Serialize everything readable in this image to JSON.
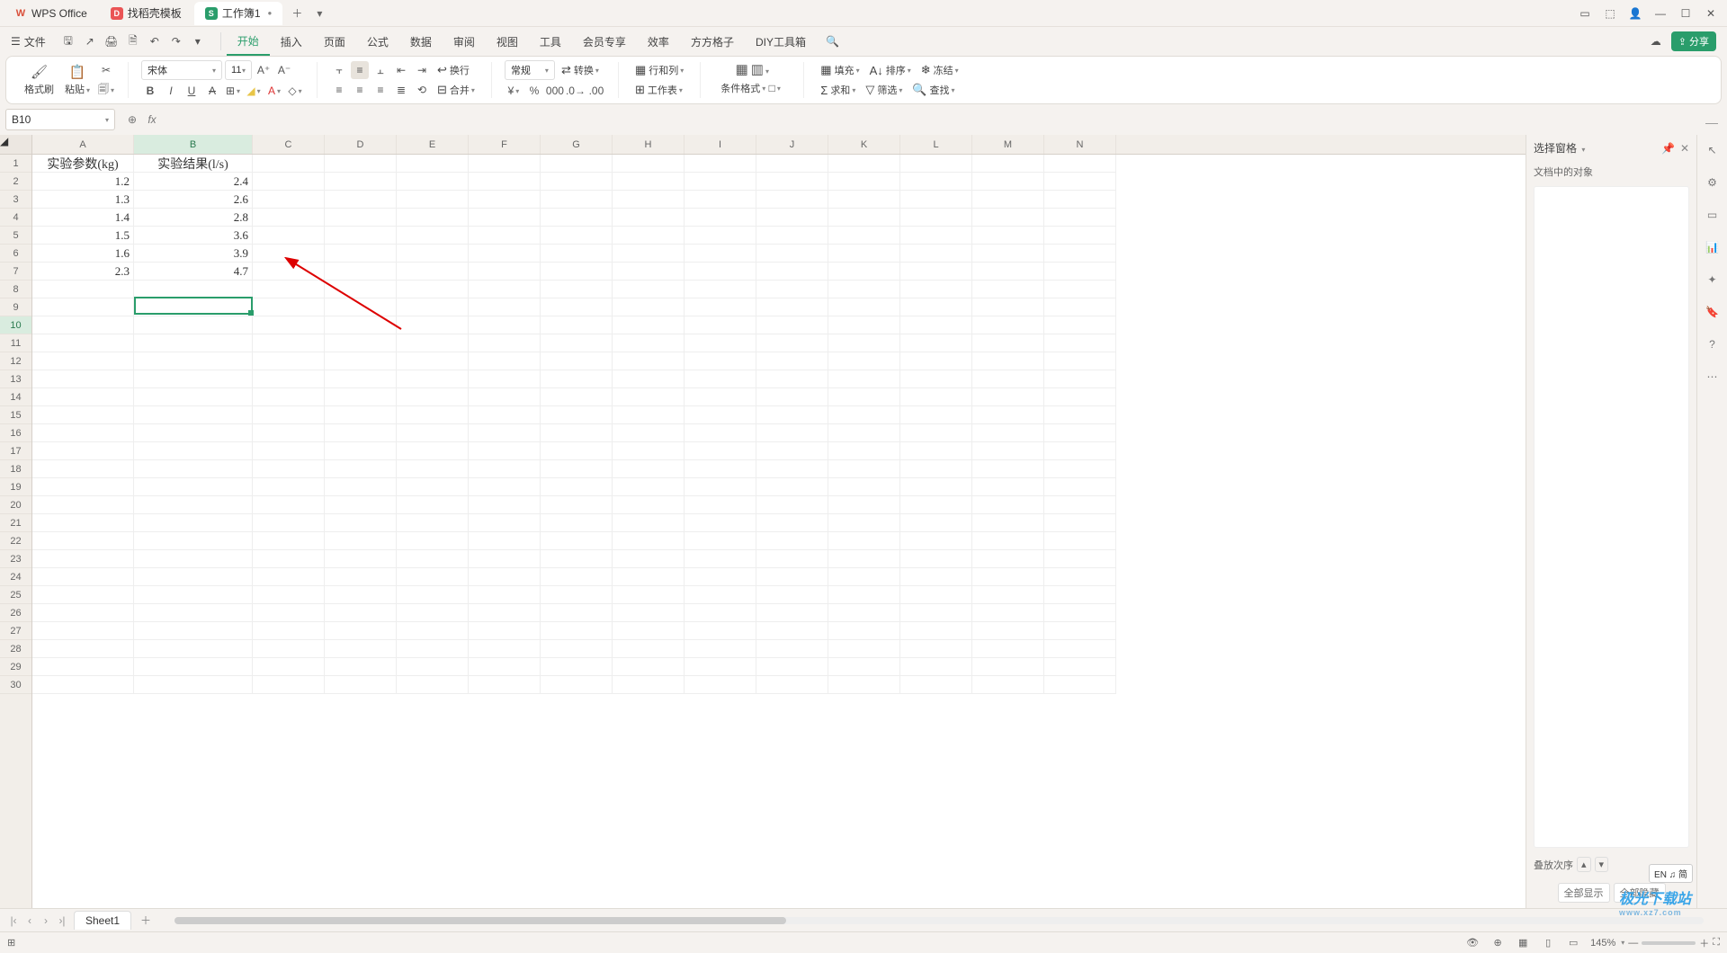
{
  "titlebar": {
    "tabs": [
      {
        "icon": "W",
        "label": "WPS Office"
      },
      {
        "icon": "D",
        "label": "找稻壳模板"
      },
      {
        "icon": "S",
        "label": "工作簿1",
        "modified": true
      }
    ]
  },
  "menubar": {
    "file": "文件",
    "items": [
      "开始",
      "插入",
      "页面",
      "公式",
      "数据",
      "审阅",
      "视图",
      "工具",
      "会员专享",
      "效率",
      "方方格子",
      "DIY工具箱"
    ],
    "active_index": 0,
    "share": "分享"
  },
  "ribbon": {
    "format_painter": "格式刷",
    "paste": "粘贴",
    "font_name": "宋体",
    "font_size": "11",
    "wrap": "换行",
    "merge": "合并",
    "number_format": "常规",
    "convert": "转换",
    "row_col": "行和列",
    "worksheet": "工作表",
    "cond_fmt": "条件格式",
    "fill": "填充",
    "sort": "排序",
    "freeze": "冻结",
    "sum": "求和",
    "filter": "筛选",
    "find": "查找"
  },
  "namebox": "B10",
  "columns": [
    "A",
    "B",
    "C",
    "D",
    "E",
    "F",
    "G",
    "H",
    "I",
    "J",
    "K",
    "L",
    "M",
    "N"
  ],
  "selected_col_index": 1,
  "rows_visible": 30,
  "selected_row": 10,
  "data_headers": [
    "实验参数(kg)",
    "实验结果(l/s)"
  ],
  "data_rows": [
    [
      "1.2",
      "2.4"
    ],
    [
      "1.3",
      "2.6"
    ],
    [
      "1.4",
      "2.8"
    ],
    [
      "1.5",
      "3.6"
    ],
    [
      "1.6",
      "3.9"
    ],
    [
      "2.3",
      "4.7"
    ]
  ],
  "selection": {
    "row": 10,
    "col": 1
  },
  "rightpane": {
    "title": "选择窗格",
    "subtitle": "文档中的对象",
    "stack_order": "叠放次序",
    "show_all": "全部显示",
    "hide_all": "全部隐藏"
  },
  "sheettabs": {
    "active": "Sheet1"
  },
  "statusbar": {
    "zoom": "145%"
  },
  "ime": "EN ♫ 简",
  "watermark": {
    "main": "极光下载站",
    "sub": "www.xz7.com"
  }
}
